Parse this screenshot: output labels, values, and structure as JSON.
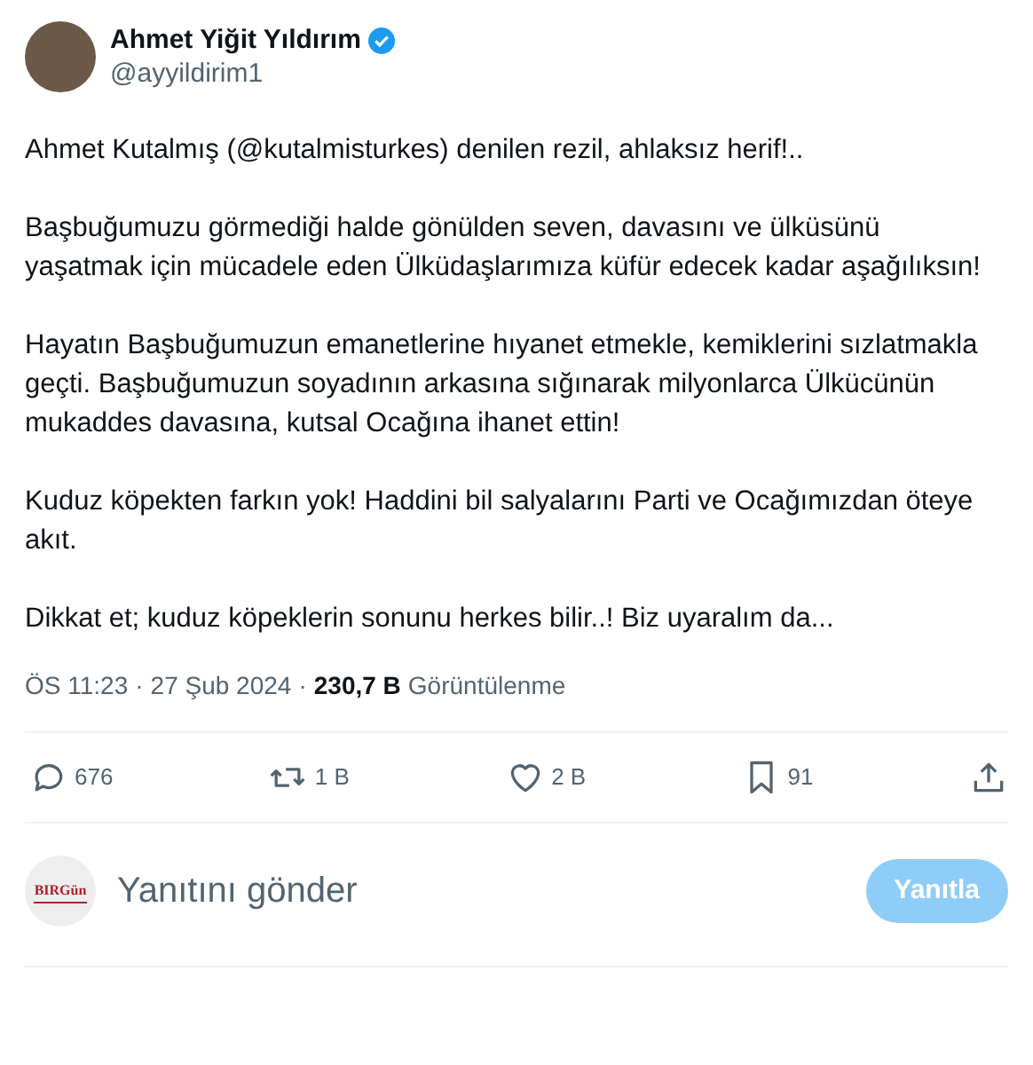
{
  "author": {
    "name": "Ahmet Yiğit Yıldırım",
    "verified": true,
    "handle": "@ayyildirim1"
  },
  "paragraphs": [
    "Ahmet Kutalmış (@kutalmisturkes) denilen rezil, ahlaksız herif!..",
    "Başbuğumuzu görmediği halde gönülden seven, davasını ve ülküsünü yaşatmak için mücadele eden Ülküdaşlarımıza küfür edecek kadar aşağılıksın!",
    "Hayatın Başbuğumuzun emanetlerine hıyanet etmekle, kemiklerini sızlatmakla geçti. Başbuğumuzun soyadının arkasına sığınarak milyonlarca Ülkücünün mukaddes davasına, kutsal Ocağına ihanet ettin!",
    "Kuduz köpekten farkın yok! Haddini bil salyalarını Parti ve Ocağımızdan öteye akıt.",
    "Dikkat et; kuduz köpeklerin sonunu herkes bilir..! Biz uyaralım da..."
  ],
  "meta": {
    "time": "ÖS 11:23",
    "separator": "·",
    "date": "27 Şub 2024",
    "separator_2": "·",
    "views": "230,7 B",
    "views_label": "Görüntülenme"
  },
  "actions": [
    {
      "kind": "reply",
      "count": "676"
    },
    {
      "kind": "repost",
      "count": "1 B"
    },
    {
      "kind": "like",
      "count": "2 B"
    },
    {
      "kind": "bookmark",
      "count": "91"
    },
    {
      "kind": "share"
    }
  ],
  "composer": {
    "avatar_text": "BIRGün",
    "placeholder": "Yanıtını gönder",
    "button": "Yanıtla",
    "disabled": true
  }
}
